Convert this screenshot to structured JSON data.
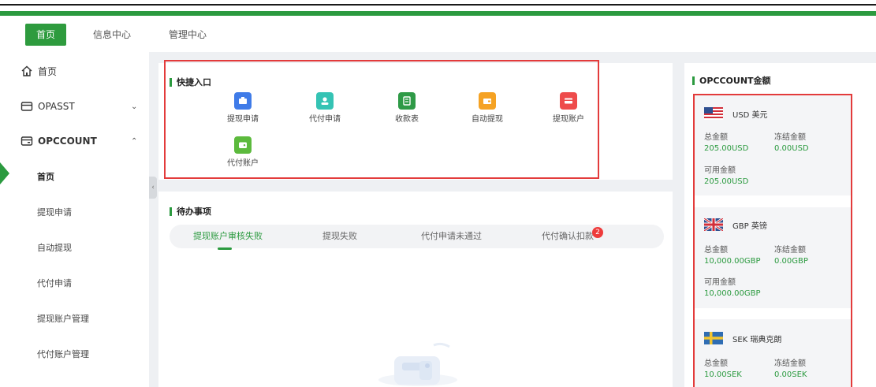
{
  "topnav": {
    "tabs": [
      {
        "label": "首页",
        "active": true
      },
      {
        "label": "信息中心",
        "active": false
      },
      {
        "label": "管理中心",
        "active": false
      }
    ]
  },
  "sidebar": {
    "home": "首页",
    "opasst": "OPASST",
    "opccount": "OPCCOUNT",
    "subs": [
      "首页",
      "提现申请",
      "自动提现",
      "代付申请",
      "提现账户管理",
      "代付账户管理"
    ]
  },
  "quick": {
    "title": "快捷入口",
    "items": [
      {
        "label": "提现申请",
        "color": "#3f7be8",
        "icon": "card-icon"
      },
      {
        "label": "代付申请",
        "color": "#35c3b4",
        "icon": "user-icon"
      },
      {
        "label": "收款表",
        "color": "#2f9a47",
        "icon": "receipt-icon"
      },
      {
        "label": "自动提现",
        "color": "#f5a223",
        "icon": "wallet-icon"
      },
      {
        "label": "提现账户",
        "color": "#ee4b4b",
        "icon": "bank-card-icon"
      },
      {
        "label": "代付账户",
        "color": "#5cba3d",
        "icon": "purse-icon"
      }
    ]
  },
  "todo": {
    "title": "待办事项",
    "tabs": [
      {
        "label": "提现账户审核失败",
        "active": true
      },
      {
        "label": "提现失败",
        "active": false
      },
      {
        "label": "代付申请未通过",
        "active": false
      },
      {
        "label": "代付确认扣款",
        "active": false
      }
    ],
    "badge": "2"
  },
  "amounts": {
    "title": "OPCCOUNT金额",
    "total_label": "总金额",
    "frozen_label": "冻结金额",
    "available_label": "可用金额",
    "currencies": [
      {
        "name": "USD 美元",
        "total": "205.00USD",
        "frozen": "0.00USD",
        "available": "205.00USD",
        "flag": "us-flag-icon"
      },
      {
        "name": "GBP 英镑",
        "total": "10,000.00GBP",
        "frozen": "0.00GBP",
        "available": "10,000.00GBP",
        "flag": "uk-flag-icon"
      },
      {
        "name": "SEK 瑞典克朗",
        "total": "10.00SEK",
        "frozen": "0.00SEK",
        "available": "",
        "flag": "se-flag-icon"
      }
    ]
  },
  "colors": {
    "accent": "#2b9a3f",
    "highlight": "#e33b3b"
  }
}
